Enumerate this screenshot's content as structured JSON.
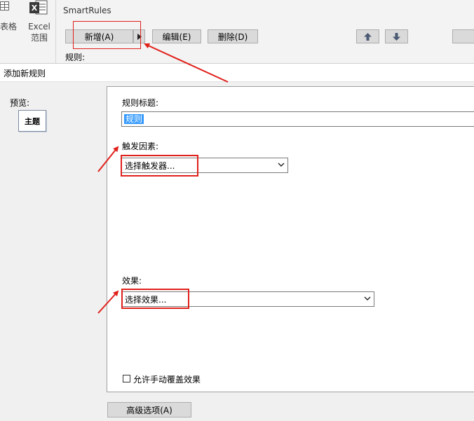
{
  "ribbon": {
    "table_label": "表格",
    "excel_label": "Excel",
    "range_label": "范围"
  },
  "smartrules": {
    "panel_title": "SmartRules",
    "new_label": "新增(A)",
    "edit_label": "编辑(E)",
    "delete_label": "删除(D)",
    "rules_label": "规则:"
  },
  "dialog": {
    "title": "添加新规则",
    "preview_label": "预览:",
    "preview_item": "主题",
    "rule_title_label": "规则标题:",
    "rule_title_value": "规则",
    "trigger_label": "触发因素:",
    "trigger_value": "选择触发器...",
    "effect_label": "效果:",
    "effect_value": "选择效果...",
    "override_label": "允许手动覆盖效果",
    "override_checked": false,
    "advanced_label": "高级选项(A)"
  },
  "colors": {
    "annotation_red": "#e0201b",
    "selection_blue": "#3399ff"
  }
}
